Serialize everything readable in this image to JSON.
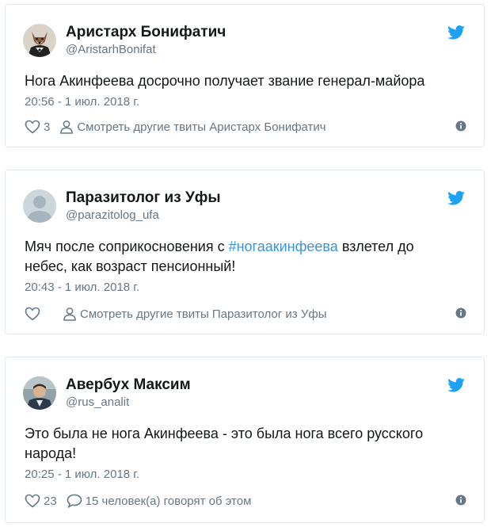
{
  "tweets": [
    {
      "name": "Аристарх Бонифатич",
      "handle": "@AristarhBonifat",
      "text_before": "Нога Акинфеева досрочно получает звание генерал-майора",
      "hashtag": "",
      "text_after": "",
      "date": "20:56 - 1 июл. 2018 г.",
      "likes": "3",
      "secondary_action": "Смотреть другие твиты Аристарх Бонифатич"
    },
    {
      "name": "Паразитолог из Уфы",
      "handle": "@parazitolog_ufa",
      "text_before": "Мяч после соприкосновения с ",
      "hashtag": "#ногаакинфеева",
      "text_after": " взлетел до небес, как возраст пенсионный!",
      "date": "20:43 - 1 июл. 2018 г.",
      "likes": "",
      "secondary_action": "Смотреть другие твиты Паразитолог из Уфы"
    },
    {
      "name": "Авербух Максим",
      "handle": "@rus_analit",
      "text_before": "Это была не нога Акинфеева - это была нога всего русского народа!",
      "hashtag": "",
      "text_after": "",
      "date": "20:25 - 1 июл. 2018 г.",
      "likes": "23",
      "secondary_action": "15 человек(а) говорят об этом"
    }
  ],
  "colors": {
    "twitter_blue": "#1da1f2",
    "link": "#3b94d9",
    "muted": "#657786",
    "border": "#e1e8ed"
  },
  "icons": {
    "logo": "twitter-bird-icon",
    "like": "heart-icon",
    "profile": "person-icon",
    "comments": "speech-bubble-icon",
    "info": "info-icon"
  }
}
